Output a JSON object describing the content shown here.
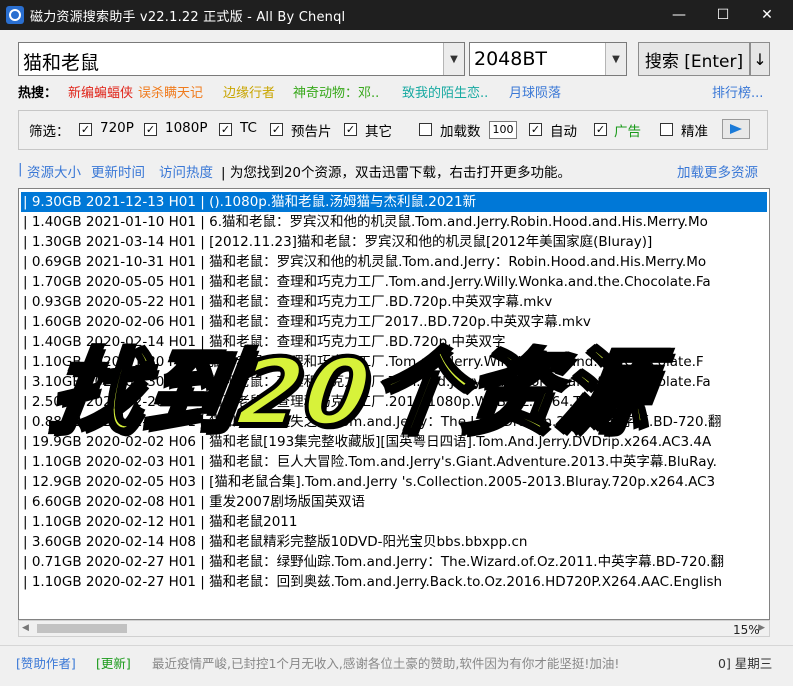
{
  "window": {
    "title": "磁力资源搜索助手 v22.1.22 正式版 - All By Chenql",
    "min_label": "—",
    "max_label": "☐",
    "close_label": "✕"
  },
  "search": {
    "keyword": "猫和老鼠",
    "source": "2048BT",
    "button_label": "搜索 [Enter]",
    "extra_label": "↓"
  },
  "hot": {
    "label": "热搜：",
    "items": [
      {
        "text": "新编蝙蝠侠",
        "color": "#e0261b"
      },
      {
        "text": "误杀瞒天记",
        "color": "#f07b1d"
      },
      {
        "text": "边缘行者",
        "color": "#c9a500"
      },
      {
        "text": "神奇动物：邓..",
        "color": "#37a81a"
      },
      {
        "text": "致我的陌生恋..",
        "color": "#17a9a1"
      },
      {
        "text": "月球陨落",
        "color": "#3a78d6"
      }
    ],
    "rank_link": "排行榜..."
  },
  "filters": {
    "label": "筛选：",
    "options": [
      {
        "label": "720P",
        "checked": true
      },
      {
        "label": "1080P",
        "checked": true
      },
      {
        "label": "TC",
        "checked": true
      },
      {
        "label": "预告片",
        "checked": true
      },
      {
        "label": "其它",
        "checked": true
      }
    ],
    "load_count_label": "加载数",
    "load_count_checked": false,
    "load_count_value": "100",
    "auto_label": "自动",
    "auto_checked": true,
    "ads_label": "广告",
    "ads_checked": true,
    "ads_color": "#1a9a1a",
    "precise_label": "精准",
    "precise_checked": false
  },
  "sortbar": {
    "prefix": "|",
    "size_label": "资源大小",
    "time_label": "更新时间",
    "heat_label": "访问热度",
    "status_text": "| 为您找到20个资源，双击迅雷下载，右击打开更多功能。",
    "load_more": "加载更多资源"
  },
  "results": [
    "| 9.30GB 2021-12-13 H01 | ().1080p.猫和老鼠.汤姆猫与杰利鼠.2021新",
    "| 1.40GB 2021-01-10 H01 | 6.猫和老鼠：罗宾汉和他的机灵鼠.Tom.and.Jerry.Robin.Hood.and.His.Merry.Mo",
    "| 1.30GB 2021-03-14 H01 | [2012.11.23]猫和老鼠：罗宾汉和他的机灵鼠[2012年美国家庭(Bluray)]",
    "| 0.69GB 2021-10-31 H01 | 猫和老鼠：罗宾汉和他的机灵鼠.Tom.and.Jerry：Robin.Hood.and.His.Merry.Mo",
    "| 1.70GB 2020-05-05 H01 | 猫和老鼠：查理和巧克力工厂.Tom.and.Jerry.Willy.Wonka.and.the.Chocolate.Fa",
    "| 0.93GB 2020-05-22 H01 | 猫和老鼠：查理和巧克力工厂.BD.720p.中英双字幕.mkv",
    "| 1.60GB 2020-02-06 H01 | 猫和老鼠：查理和巧克力工厂2017..BD.720p.中英双字幕.mkv",
    "| 1.40GB 2020-02-14 H01 | 猫和老鼠：查理和巧克力工厂.BD.720p.中英双字",
    "| 1.10GB 2020-01-30 H01 | 猫和老鼠：查理和巧克力工厂.Tom.and.Jerry.Willy.Wonka.and.the.Chocolate.F",
    "| 3.10GB 2020-01-30 H01 | 猫和老鼠：查理和巧克力工厂.Tom.and.Jerry.Willy.Wonka.and.the.Chocolate.Fa",
    "| 2.50GB 2020-02-20 H01 | 猫和老鼠：查理和巧克力工厂.2017.1080p.WEB-DL.H264.TBT4K",
    "| 0.88GB 2020-01-20 H01 | 猫和老鼠：迷失之龙.Tom.and.Jerry：The.Lost.Dragon.2014.中英字幕.BD-720.翻",
    "| 19.9GB 2020-02-02 H06 | 猫和老鼠[193集完整收藏版][国英粤日四语].Tom.And.Jerry.DVDrip.x264.AC3.4A",
    "| 1.10GB 2020-02-03 H01 | 猫和老鼠：巨人大冒险.Tom.and.Jerry's.Giant.Adventure.2013.中英字幕.BluRay.",
    "| 12.9GB 2020-02-05 H03 | [猫和老鼠合集].Tom.and.Jerry 's.Collection.2005-2013.Bluray.720p.x264.AC3",
    "| 6.60GB 2020-02-08 H01 | 重发2007剧场版国英双语",
    "| 1.10GB 2020-02-12 H01 | 猫和老鼠2011",
    "| 3.60GB 2020-02-14 H08 | 猫和老鼠精彩完整版10DVD-阳光宝贝bbs.bbxpp.cn",
    "| 0.71GB 2020-02-27 H01 | 猫和老鼠：绿野仙踪.Tom.and.Jerry：The.Wizard.of.Oz.2011.中英字幕.BD-720.翻",
    "| 1.10GB 2020-02-27 H01 | 猫和老鼠：回到奥兹.Tom.and.Jerry.Back.to.Oz.2016.HD720P.X264.AAC.English"
  ],
  "progress": {
    "value": 0.15,
    "text": "15%"
  },
  "statusbar": {
    "sponsor": "[赞助作者]",
    "update": "[更新]",
    "message": "最近疫情严峻,已封控1个月无收入,感谢各位土豪的赞助,软件因为有你才能坚挺!加油!",
    "date": "0] 星期三"
  },
  "overlay_text": "找到20个资源",
  "colors": {
    "selection": "#0078d7",
    "link": "#3a78d6",
    "overlay_fill": "#d7f23a"
  }
}
